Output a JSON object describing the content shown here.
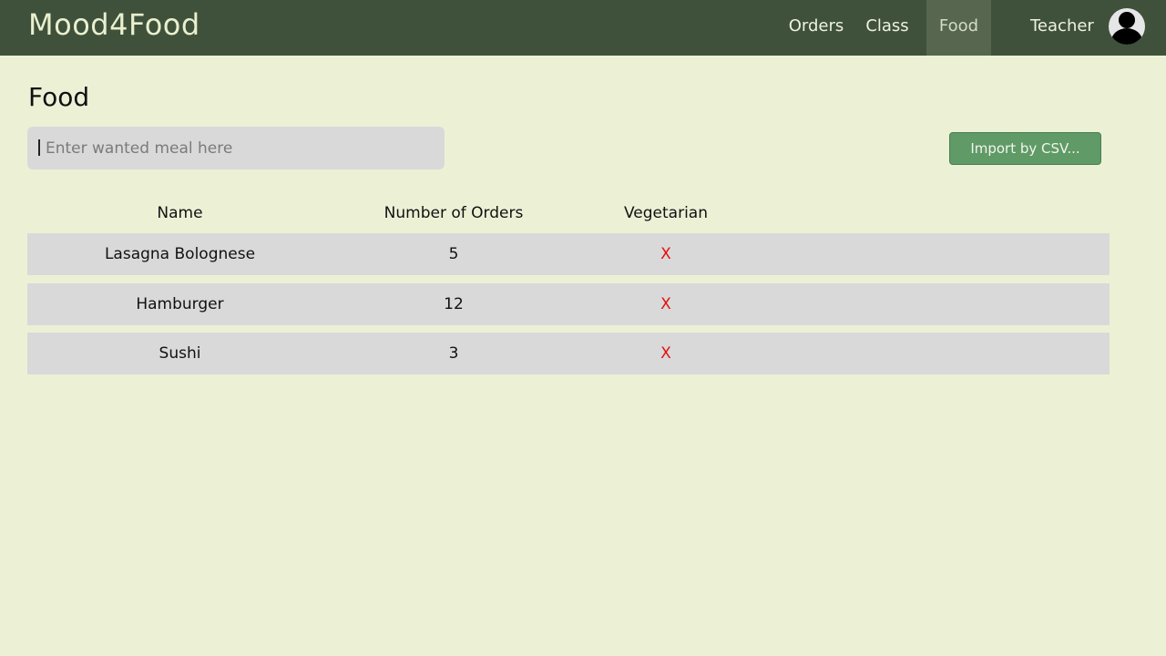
{
  "app": {
    "brand": "Mood4Food"
  },
  "nav": {
    "orders": "Orders",
    "class": "Class",
    "food": "Food",
    "active": "Food",
    "user": "Teacher"
  },
  "page": {
    "title": "Food"
  },
  "search": {
    "placeholder": "Enter wanted meal here",
    "value": ""
  },
  "toolbar": {
    "import_label": "Import by CSV..."
  },
  "table": {
    "headers": [
      "Name",
      "Number of Orders",
      "Vegetarian"
    ],
    "rows": [
      {
        "name": "Lasagna Bolognese",
        "orders": "5",
        "vegetarian": "X"
      },
      {
        "name": "Hamburger",
        "orders": "12",
        "vegetarian": "X"
      },
      {
        "name": "Sushi",
        "orders": "3",
        "vegetarian": "X"
      }
    ]
  },
  "colors": {
    "navbar": "#3f513a",
    "background": "#ecf1d6",
    "button": "#5f9a67",
    "no_mark": "#e31010"
  },
  "icons": {
    "avatar": "user-avatar-icon"
  }
}
